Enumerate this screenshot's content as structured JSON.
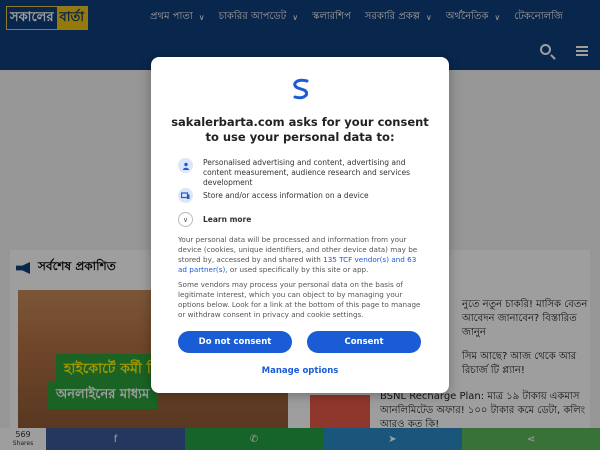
{
  "site": {
    "logo_part1": "সকালের",
    "logo_part2": "বার্তা",
    "nav": [
      "প্রথম পাতা",
      "চাকরির আপডেট",
      "স্কলারশিপ",
      "সরকারি প্রকল্প",
      "অর্থনৈতিক",
      "টেকনোলজি"
    ],
    "latest_heading": "সর্বশেষ প্রকাশিত",
    "feature_caption1": "হাইকোর্টে কর্মী নি",
    "feature_caption2": "অনলাইনের মাধ্যম",
    "side_news1": "নুতে নতুন চাকরি! মাসিক বেতন আবেদন জানাবেন? বিস্তারিত জানুন",
    "side_news2": "সিম আছে? আজ থেকে আর রিচার্জ টি প্ল্যান!",
    "bsnl_news": "BSNL Recharge Plan: মাত্র ১৯ টাকায় একমাস আনলিমিটেড অফার! ১০০ টাকার কমে ডেটা, কলিং আরও কত কি!",
    "share_count": "569",
    "share_label": "Shares",
    "share_buttons": [
      {
        "icon": "f",
        "name": "facebook",
        "color": "#3b5998"
      },
      {
        "icon": "✆",
        "name": "whatsapp",
        "color": "#25a244"
      },
      {
        "icon": "➤",
        "name": "telegram",
        "color": "#2a8bc9"
      },
      {
        "icon": "⋖",
        "name": "share",
        "color": "#5cb85c"
      }
    ]
  },
  "consent": {
    "title": "sakalerbarta.com asks for your consent to use your personal data to:",
    "purposes": [
      {
        "icon": "person-icon",
        "text": "Personalised advertising and content, advertising and content measurement, audience research and services development"
      },
      {
        "icon": "device-icon",
        "text": "Store and/or access information on a device"
      }
    ],
    "learn_more": "Learn more",
    "para1_before": "Your personal data will be processed and information from your device (cookies, unique identifiers, and other device data) may be stored by, accessed by and shared with ",
    "para1_link": "135 TCF vendor(s) and 63 ad partner(s)",
    "para1_after": ", or used specifically by this site or app.",
    "para2": "Some vendors may process your personal data on the basis of legitimate interest, which you can object to by managing your options below. Look for a link at the bottom of this page to manage or withdraw consent in privacy and cookie settings.",
    "do_not_consent": "Do not consent",
    "consent": "Consent",
    "manage_options": "Manage options",
    "accent": "#1a5bd6"
  }
}
